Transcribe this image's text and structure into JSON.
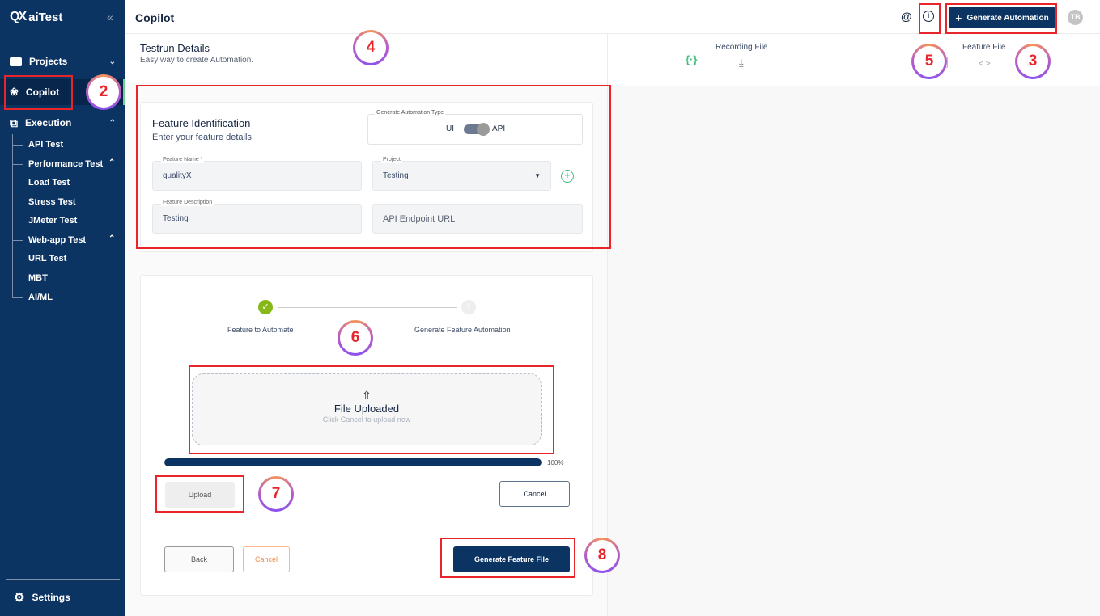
{
  "app": {
    "name": "aiTest",
    "logo_mark": "QX",
    "collapse_icon": "double-chevron-left"
  },
  "sidebar": {
    "projects": "Projects",
    "copilot": "Copilot",
    "execution": "Execution",
    "sub_items": [
      "API Test",
      "Performance Test",
      "Load Test",
      "Stress Test",
      "JMeter Test",
      "Web-app Test",
      "URL Test",
      "MBT",
      "AI/ML"
    ],
    "settings": "Settings"
  },
  "header": {
    "title": "Copilot",
    "at_icon": "@",
    "info_icon": "i",
    "generate_automation": "Generate Automation",
    "avatar": "TB"
  },
  "details": {
    "title": "Testrun Details",
    "subtitle": "Easy way to create Automation."
  },
  "right_panel": {
    "recording_file": "Recording File",
    "feature_file": "Feature File"
  },
  "feature_identification": {
    "title": "Feature Identification",
    "subtitle": "Enter your feature details.",
    "automation_type": {
      "label": "Generate Automation Type",
      "left": "UI",
      "right": "API",
      "selected": "API"
    },
    "feature_name": {
      "label": "Feature Name *",
      "value": "qualityX"
    },
    "project": {
      "label": "Project",
      "value": "Testing"
    },
    "feature_description": {
      "label": "Feature Description",
      "value": "Testing"
    },
    "api_endpoint": {
      "placeholder": "API Endpoint URL"
    }
  },
  "stepper": {
    "step1": "Feature to Automate",
    "step2": "Generate Feature Automation",
    "step2_number": "2"
  },
  "upload": {
    "title": "File Uploaded",
    "hint": "Click Cancel to upload new",
    "progress_percent": 100,
    "progress_label": "100%",
    "upload_btn": "Upload",
    "cancel_btn": "Cancel"
  },
  "footer": {
    "back": "Back",
    "cancel": "Cancel",
    "generate": "Generate Feature File"
  },
  "annotations": [
    "2",
    "3",
    "4",
    "5",
    "6",
    "7",
    "8"
  ]
}
